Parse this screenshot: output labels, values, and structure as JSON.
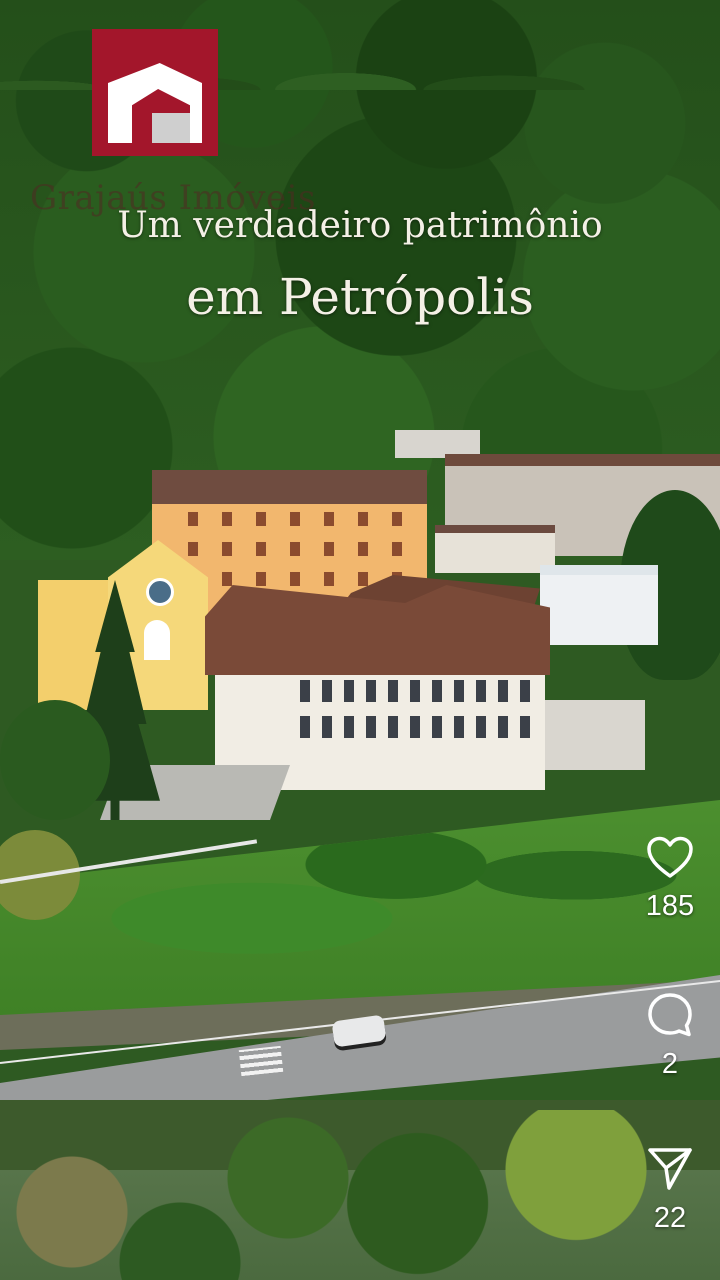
{
  "brand": {
    "name": "Grajaús Imóveis",
    "logo_color": "#a3162b"
  },
  "headline": {
    "line1": "Um verdadeiro patrimônio",
    "line2": "em Petrópolis"
  },
  "actions": {
    "like": {
      "icon": "heart-icon",
      "count": "185"
    },
    "comment": {
      "icon": "comment-bubble-icon",
      "count": "2"
    },
    "share": {
      "icon": "send-icon",
      "count": "22"
    }
  }
}
